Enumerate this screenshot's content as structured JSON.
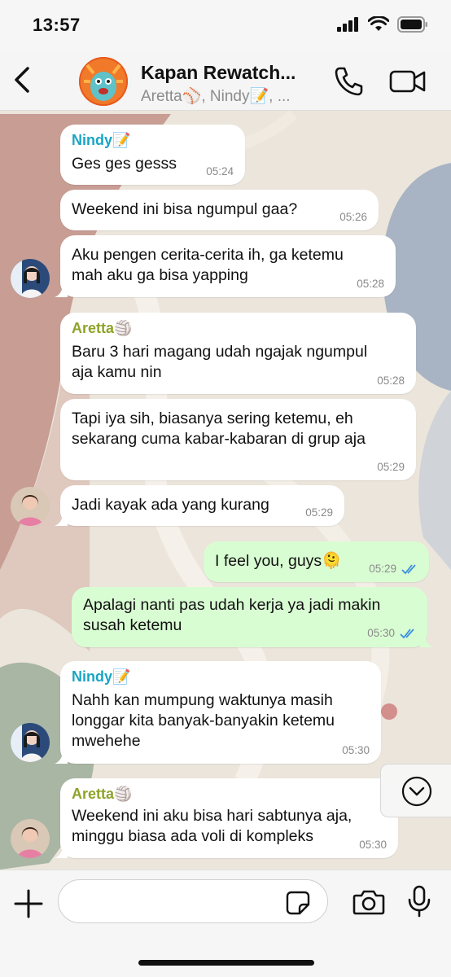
{
  "status": {
    "time": "13:57"
  },
  "header": {
    "title": "Kapan Rewatch...",
    "members": "Aretta⚾, Nindy📝, ..."
  },
  "colors": {
    "nindy": "#1aa5c4",
    "aretta": "#8ea328",
    "bubble_in": "#ffffff",
    "bubble_out": "#d9fdd3",
    "tick": "#3b8fe0"
  },
  "messages": [
    {
      "sender": "Nindy📝",
      "text": "Ges ges gesss",
      "time": "05:24"
    },
    {
      "text": "Weekend ini bisa ngumpul gaa?",
      "time": "05:26"
    },
    {
      "text": "Aku pengen cerita-cerita ih, ga ketemu\nmah aku ga bisa yapping",
      "time": "05:28"
    },
    {
      "sender": "Aretta🏐",
      "text": "Baru 3 hari magang udah ngajak ngumpul\naja kamu nin",
      "time": "05:28"
    },
    {
      "text": "Tapi iya sih, biasanya sering ketemu, eh\nsekarang cuma kabar-kabaran di grup aja",
      "time": "05:29"
    },
    {
      "text": "Jadi kayak ada yang kurang",
      "time": "05:29"
    },
    {
      "text": "I feel you, guys🫠",
      "time": "05:29",
      "outgoing": true
    },
    {
      "text": "Apalagi nanti pas udah kerja ya jadi makin\nsusah ketemu",
      "time": "05:30",
      "outgoing": true
    },
    {
      "sender": "Nindy📝",
      "text": "Nahh kan mumpung waktunya masih\nlonggar kita banyak-banyakin ketemu\nmwehehe",
      "time": "05:30"
    },
    {
      "sender": "Aretta🏐",
      "text": "Weekend ini aku bisa hari sabtunya aja,\nminggu biasa ada voli di kompleks",
      "time": "05:30"
    }
  ],
  "composer": {
    "value": "",
    "placeholder": ""
  },
  "icons": {
    "back": "chevron-left-icon",
    "call": "phone-icon",
    "video": "video-camera-icon",
    "scroll": "chevron-down-icon",
    "plus": "plus-icon",
    "sticker": "sticker-icon",
    "camera": "camera-icon",
    "mic": "microphone-icon"
  }
}
